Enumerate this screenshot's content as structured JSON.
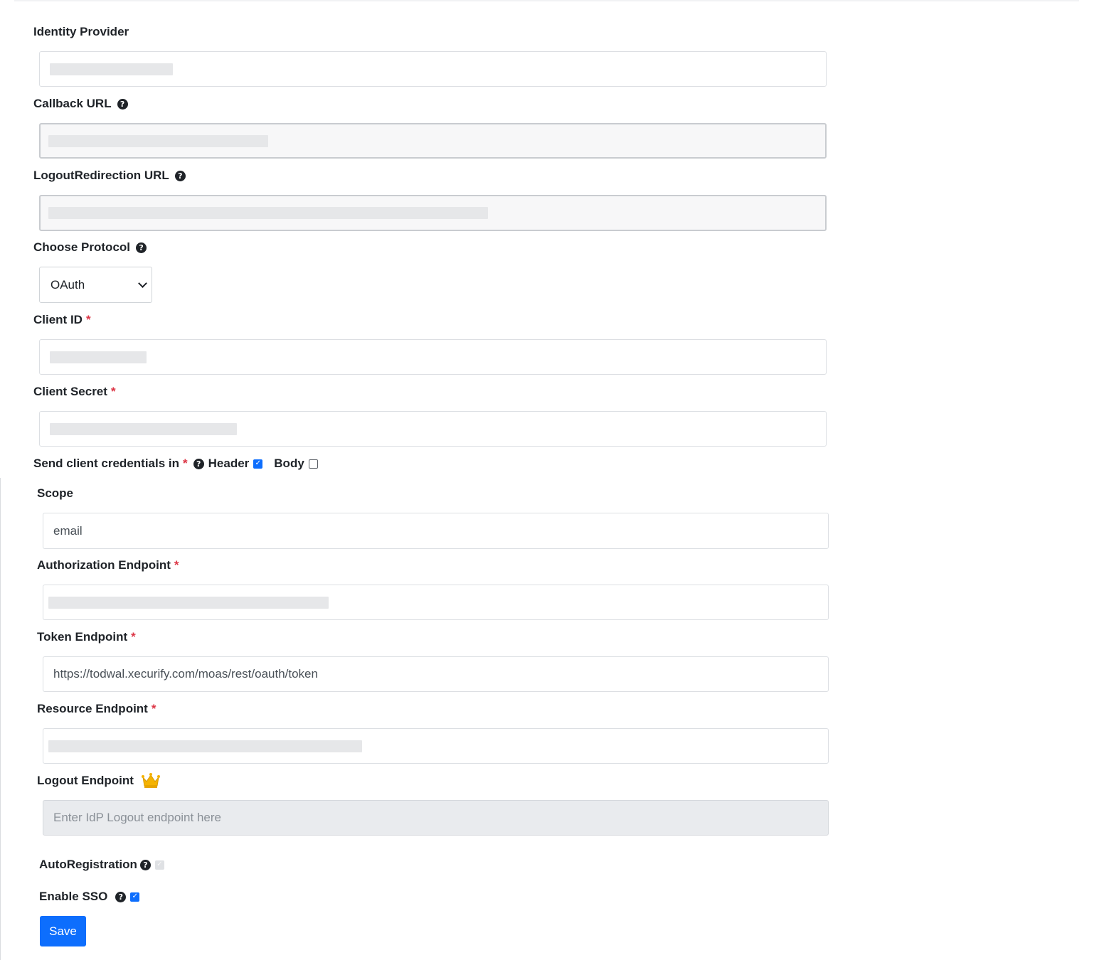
{
  "form": {
    "identity_provider": {
      "label": "Identity Provider"
    },
    "callback_url": {
      "label": "Callback URL"
    },
    "logout_redirection_url": {
      "label": "LogoutRedirection URL"
    },
    "protocol": {
      "label": "Choose Protocol",
      "selected": "OAuth"
    },
    "client_id": {
      "label": "Client ID",
      "required_mark": "*"
    },
    "client_secret": {
      "label": "Client Secret",
      "required_mark": "*"
    },
    "credentials": {
      "label": "Send client credentials in",
      "required_mark": "*",
      "header_label": "Header",
      "header_checked": true,
      "body_label": "Body",
      "body_checked": false
    },
    "scope": {
      "label": "Scope",
      "value": "email"
    },
    "authorization_endpoint": {
      "label": "Authorization Endpoint",
      "required_mark": "*"
    },
    "token_endpoint": {
      "label": "Token Endpoint",
      "required_mark": "*",
      "value": "https://todwal.xecurify.com/moas/rest/oauth/token"
    },
    "resource_endpoint": {
      "label": "Resource Endpoint",
      "required_mark": "*"
    },
    "logout_endpoint": {
      "label": "Logout Endpoint",
      "placeholder": "Enter IdP Logout endpoint here",
      "premium_icon": "crown-icon"
    },
    "auto_registration": {
      "label": "AutoRegistration",
      "checked": true,
      "disabled": true
    },
    "enable_sso": {
      "label": "Enable SSO",
      "checked": true
    },
    "save_label": "Save"
  },
  "colors": {
    "primary": "#0d6efd",
    "required": "#dc3545",
    "crown": "#f5b301"
  },
  "icons": {
    "help": "question-circle-icon",
    "dropdown": "chevron-down-icon",
    "premium": "crown-icon"
  }
}
